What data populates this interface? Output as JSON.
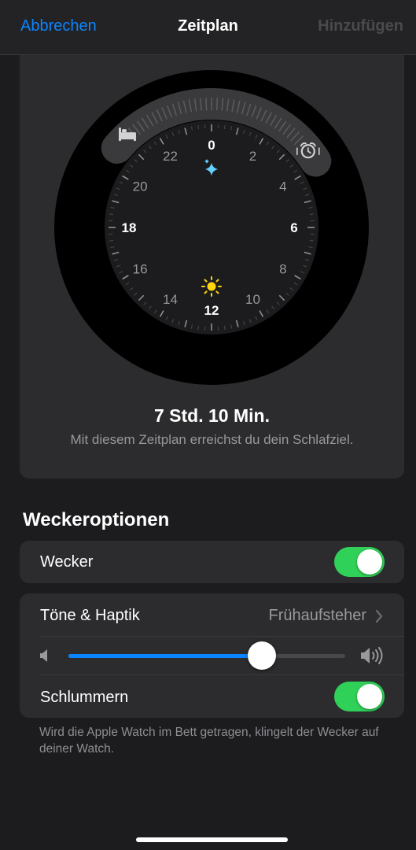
{
  "nav": {
    "cancel_label": "Abbrechen",
    "title": "Zeitplan",
    "add_label": "Hinzufügen"
  },
  "clock": {
    "hour_labels": [
      "0",
      "2",
      "4",
      "6",
      "8",
      "10",
      "12",
      "14",
      "16",
      "18",
      "20",
      "22"
    ],
    "bedtime_icon": "bed-icon",
    "wake_icon": "alarm-clock-icon",
    "midnight_icon": "sparkles-icon",
    "noon_icon": "sun-icon",
    "duration": "7 Std. 10 Min.",
    "goal_text": "Mit diesem Zeitplan erreichst du dein Schlafziel."
  },
  "alarm_options": {
    "section_title": "Weckeroptionen",
    "alarm_label": "Wecker",
    "alarm_on": true,
    "sounds_label": "Töne & Haptik",
    "sounds_value": "Frühaufsteher",
    "volume_level": 0.7,
    "snooze_label": "Schlummern",
    "snooze_on": true,
    "footnote": "Wird die Apple Watch im Bett getragen, klingelt der Wecker auf deiner Watch."
  },
  "colors": {
    "accent": "#0a84ff",
    "toggle_on": "#30d158",
    "background": "#1c1c1e",
    "card": "#2c2c2e",
    "sun": "#ffd60a",
    "sparkle": "#64d2ff"
  }
}
